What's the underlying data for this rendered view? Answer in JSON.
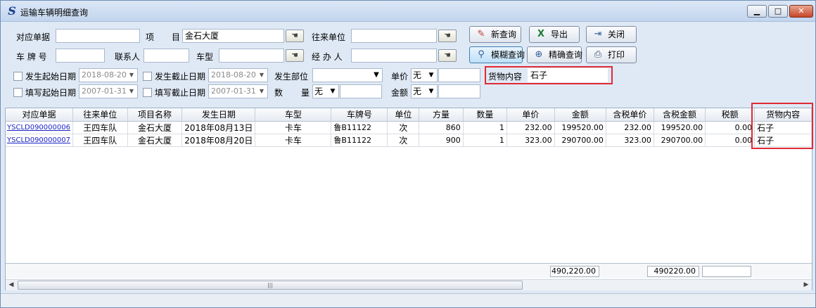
{
  "window": {
    "title": "运输车辆明细查询",
    "min_label": "▁",
    "max_label": "□",
    "close_label": "✕"
  },
  "form": {
    "order_no_label": "对应单据",
    "order_no_value": "",
    "project_label_1": "项",
    "project_label_2": "目",
    "project_value": "金石大厦",
    "partner_label": "往来单位",
    "partner_value": "",
    "plate_label": "车 牌 号",
    "plate_value": "",
    "contact_label": "联系人",
    "contact_value": "",
    "vehicle_type_label": "车型",
    "vehicle_type_value": "",
    "handler_label": "经 办 人",
    "handler_value": "",
    "start_date_label": "发生起始日期",
    "start_date_value": "2018-08-20",
    "end_date_label": "发生截止日期",
    "end_date_value": "2018-08-20",
    "dept_label": "发生部位",
    "dept_value": "",
    "unit_price_label": "单价",
    "unit_price_op": "无",
    "unit_price_value": "",
    "goods_label": "货物内容",
    "goods_value": "石子",
    "fill_start_label": "填写起始日期",
    "fill_start_value": "2007-01-31",
    "fill_end_label": "填写截止日期",
    "fill_end_value": "2007-01-31",
    "qty_label_1": "数",
    "qty_label_2": "量",
    "qty_op": "无",
    "qty_value": "",
    "amount_label": "金额",
    "amount_op": "无",
    "amount_value": ""
  },
  "buttons": {
    "new_query": "新查询",
    "export": "导出",
    "close": "关闭",
    "fuzzy_query": "模糊查询",
    "exact_query": "精确查询",
    "print": "打印"
  },
  "table": {
    "columns": [
      "对应单据",
      "往来单位",
      "项目名称",
      "发生日期",
      "车型",
      "车牌号",
      "单位",
      "方量",
      "数量",
      "单价",
      "金额",
      "含税单价",
      "含税金额",
      "税额",
      "货物内容"
    ],
    "rows": [
      [
        "YSCLD090000006",
        "王四车队",
        "金石大厦",
        "2018年08月13日",
        "卡车",
        "鲁B11122",
        "次",
        "860",
        "1",
        "232.00",
        "199520.00",
        "232.00",
        "199520.00",
        "0.00",
        "石子"
      ],
      [
        "YSCLD090000007",
        "王四车队",
        "金石大厦",
        "2018年08月20日",
        "卡车",
        "鲁B11122",
        "次",
        "900",
        "1",
        "323.00",
        "290700.00",
        "323.00",
        "290700.00",
        "0.00",
        "石子"
      ]
    ],
    "footer_amount": "490,220.00",
    "footer_tax_amount": "490220.00",
    "footer_tax": ""
  },
  "icons": {
    "app": "logistics-app-icon",
    "picker": "hand-pointer-icon"
  },
  "colors": {
    "highlight": "#e02a35",
    "link": "#1a24c4"
  }
}
